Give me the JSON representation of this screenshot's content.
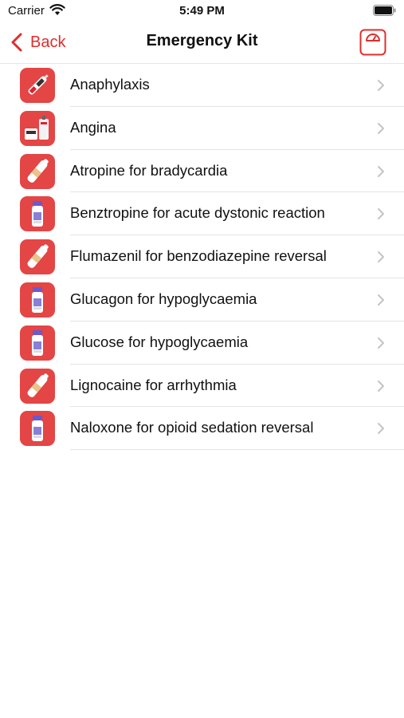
{
  "status": {
    "carrier": "Carrier",
    "time": "5:49 PM"
  },
  "nav": {
    "back_label": "Back",
    "title": "Emergency Kit",
    "accent_color": "#e02d2d"
  },
  "items": [
    {
      "label": "Anaphylaxis",
      "icon": "epipen-icon"
    },
    {
      "label": "Angina",
      "icon": "spray-and-tablets-icon"
    },
    {
      "label": "Atropine for bradycardia",
      "icon": "ampoule-icon"
    },
    {
      "label": "Benztropine for acute dystonic reaction",
      "icon": "vial-icon"
    },
    {
      "label": "Flumazenil for benzodiazepine reversal",
      "icon": "ampoule-icon"
    },
    {
      "label": "Glucagon for hypoglycaemia",
      "icon": "vial-icon"
    },
    {
      "label": "Glucose for hypoglycaemia",
      "icon": "vial-icon"
    },
    {
      "label": "Lignocaine for arrhythmia",
      "icon": "ampoule-icon"
    },
    {
      "label": "Naloxone for opioid sedation reversal",
      "icon": "vial-icon"
    }
  ]
}
